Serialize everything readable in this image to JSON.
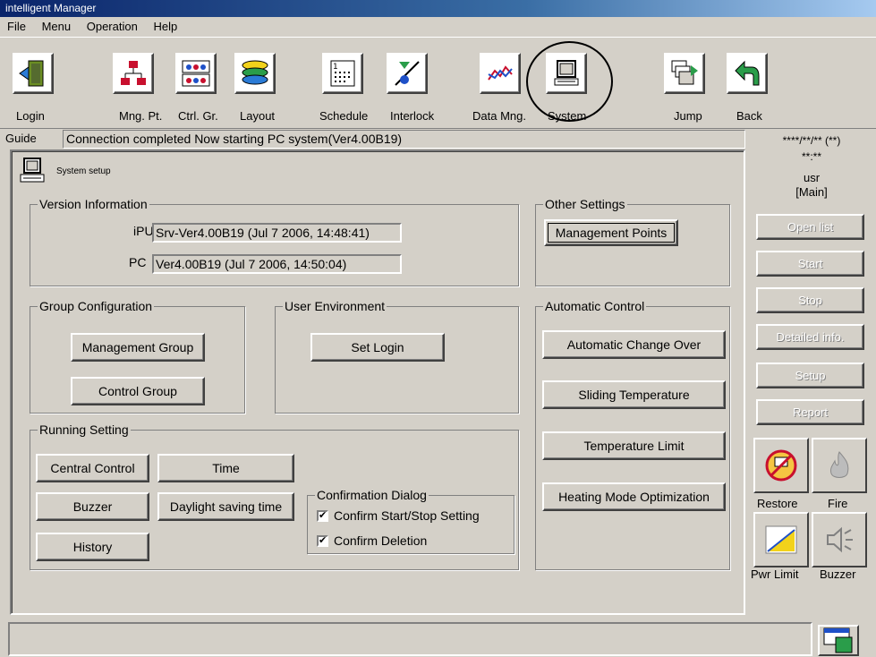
{
  "window": {
    "title": "intelligent Manager"
  },
  "menu": [
    "File",
    "Menu",
    "Operation",
    "Help"
  ],
  "toolbar": {
    "login": "Login",
    "mng_pt": "Mng. Pt.",
    "ctrl_gr": "Ctrl. Gr.",
    "layout": "Layout",
    "schedule": "Schedule",
    "interlock": "Interlock",
    "data_mng": "Data Mng.",
    "system": "System",
    "jump": "Jump",
    "back": "Back"
  },
  "guide": {
    "label": "Guide",
    "message": "Connection completed Now starting PC system(Ver4.00B19)"
  },
  "main": {
    "title": "System setup",
    "version": {
      "legend": "Version Information",
      "ipu_label": "iPU",
      "ipu_value": "Srv-Ver4.00B19 (Jul  7 2006, 14:48:41)",
      "pc_label": "PC",
      "pc_value": "Ver4.00B19 (Jul  7 2006, 14:50:04)"
    },
    "other": {
      "legend": "Other Settings",
      "management_points": "Management Points"
    },
    "group": {
      "legend": "Group Configuration",
      "management_group": "Management Group",
      "control_group": "Control Group"
    },
    "user_env": {
      "legend": "User Environment",
      "set_login": "Set Login"
    },
    "auto": {
      "legend": "Automatic Control",
      "change_over": "Automatic Change Over",
      "sliding": "Sliding Temperature",
      "temp_limit": "Temperature Limit",
      "heating": "Heating Mode Optimization"
    },
    "running": {
      "legend": "Running Setting",
      "central": "Central Control",
      "time": "Time",
      "buzzer": "Buzzer",
      "daylight": "Daylight saving time",
      "history": "History",
      "confirm": {
        "legend": "Confirmation Dialog",
        "start_stop": "Confirm Start/Stop Setting",
        "start_stop_checked": true,
        "deletion": "Confirm Deletion",
        "deletion_checked": true
      }
    }
  },
  "side": {
    "datetime": "****/**/** (**)",
    "time": "**:**",
    "user": "usr",
    "site": "[Main]",
    "open_list": "Open list",
    "start": "Start",
    "stop": "Stop",
    "detailed": "Detailed info.",
    "setup": "Setup",
    "report": "Report",
    "restore": "Restore",
    "fire": "Fire",
    "pwr_limit": "Pwr Limit",
    "buzzer": "Buzzer"
  },
  "colors": {
    "face": "#d4d0c8",
    "title_start": "#0a246a",
    "title_end": "#a6caf0"
  }
}
